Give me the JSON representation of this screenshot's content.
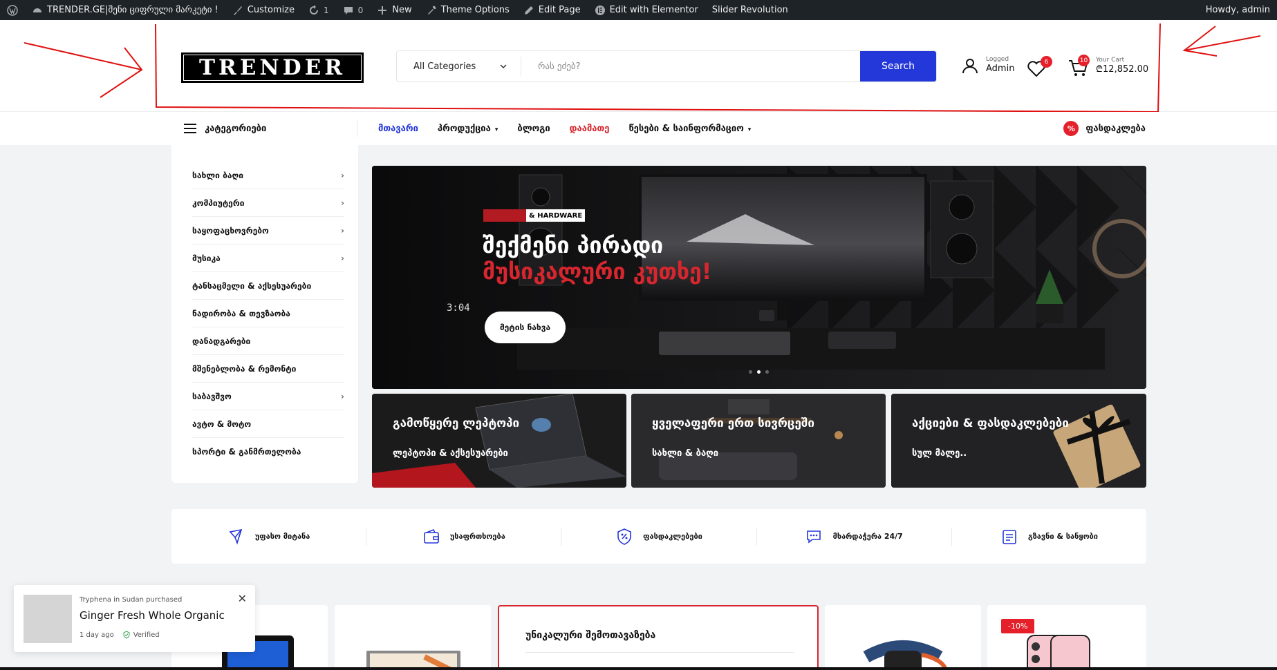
{
  "adminbar": {
    "site_title": "TRENDER.GE|შენი ციფრული მარკეტი !",
    "customize": "Customize",
    "updates_count": "1",
    "comments_count": "0",
    "new": "New",
    "theme_options": "Theme Options",
    "edit_page": "Edit Page",
    "edit_elementor": "Edit with Elementor",
    "slider_revolution": "Slider Revolution",
    "howdy": "Howdy, admin"
  },
  "header": {
    "logo_text": "TRENDER",
    "search": {
      "category": "All Categories",
      "placeholder": "რას ეძებ?",
      "button": "Search"
    },
    "user": {
      "small": "Logged",
      "name": "Admin"
    },
    "wishlist_count": "6",
    "cart": {
      "count": "10",
      "label": "Your Cart",
      "total": "₾12,852.00"
    }
  },
  "nav": {
    "categories_label": "კატეგორიები",
    "items": [
      {
        "label": "მთავარი",
        "color": "#2437d8",
        "chevron": false
      },
      {
        "label": "პროდუქცია",
        "color": "#111111",
        "chevron": true
      },
      {
        "label": "ბლოგი",
        "color": "#111111",
        "chevron": false
      },
      {
        "label": "დაამათე",
        "color": "#d7262e",
        "chevron": false
      },
      {
        "label": "წესები & საინფორმაციო",
        "color": "#111111",
        "chevron": true
      }
    ],
    "deals_label": "ფასდაკლება",
    "deals_icon": "%"
  },
  "sidemenu": [
    {
      "label": "სახლი ბაღი",
      "chevron": true
    },
    {
      "label": "კომპიუტერი",
      "chevron": true
    },
    {
      "label": "საყოფაცხოვრებო",
      "chevron": true
    },
    {
      "label": "მუსიკა",
      "chevron": true
    },
    {
      "label": "ტანსაცმელი & აქსესუარები",
      "chevron": false
    },
    {
      "label": "ნადირობა & თევზაობა",
      "chevron": false
    },
    {
      "label": "დანადგარები",
      "chevron": false
    },
    {
      "label": "მშენებლობა & რემონტი",
      "chevron": false
    },
    {
      "label": "საბავშვო",
      "chevron": true
    },
    {
      "label": "ავტო & მოტო",
      "chevron": false
    },
    {
      "label": "სპორტი & განმრთელობა",
      "chevron": false
    }
  ],
  "hero": {
    "tag": "& HARDWARE",
    "headline1": "შექმენი პირადი",
    "headline2": "მუსიკალური კუთხე!",
    "button": "მეტის ნახვა",
    "clock": "3:04"
  },
  "promos": [
    {
      "title": "გამოწყერე ლეპტოპი",
      "subtitle": "ლეპტოპი & აქსესუარები"
    },
    {
      "title": "ყველაფერი ერთ სივრცეში",
      "subtitle": "სახლი & ბაღი"
    },
    {
      "title": "აქციები & ფასდაკლებები",
      "subtitle": "სულ მალე.."
    }
  ],
  "features": [
    {
      "label": "უფასო მიტანა",
      "icon": "delivery-icon"
    },
    {
      "label": "უსაფრთხოება",
      "icon": "wallet-icon"
    },
    {
      "label": "ფასდაკლებები",
      "icon": "discount-shield-icon"
    },
    {
      "label": "მხარდაჭერა 24/7",
      "icon": "chat-support-icon"
    },
    {
      "label": "გზავნი & სანყობი",
      "icon": "clipboard-icon"
    }
  ],
  "products": {
    "unique_title": "უნიკალური შემოთავაზება",
    "discount_badge": "-10%"
  },
  "popup": {
    "who": "Tryphena in Sudan purchased",
    "product": "Ginger Fresh Whole Organic",
    "time": "1 day ago",
    "verified": "Verified"
  },
  "colors": {
    "accent": "#2437d8",
    "red": "#d7262e",
    "adminbar": "#1d2327"
  }
}
